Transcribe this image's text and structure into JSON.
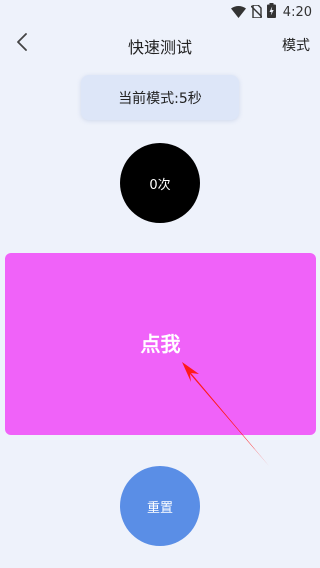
{
  "status_bar": {
    "time": "4:20",
    "icons": [
      "wifi-icon",
      "no-sim-icon",
      "battery-charging-icon"
    ]
  },
  "nav": {
    "back_icon": "chevron-left-icon",
    "title": "快速测试",
    "mode_label": "模式"
  },
  "mode_display": "当前模式:5秒",
  "counter": "0次",
  "tap_button": {
    "label": "点我",
    "color": "#f062f9"
  },
  "annotation": {
    "arrow_color": "#ff1a1a"
  },
  "reset_button": {
    "label": "重置",
    "color": "#5a8ee6"
  }
}
